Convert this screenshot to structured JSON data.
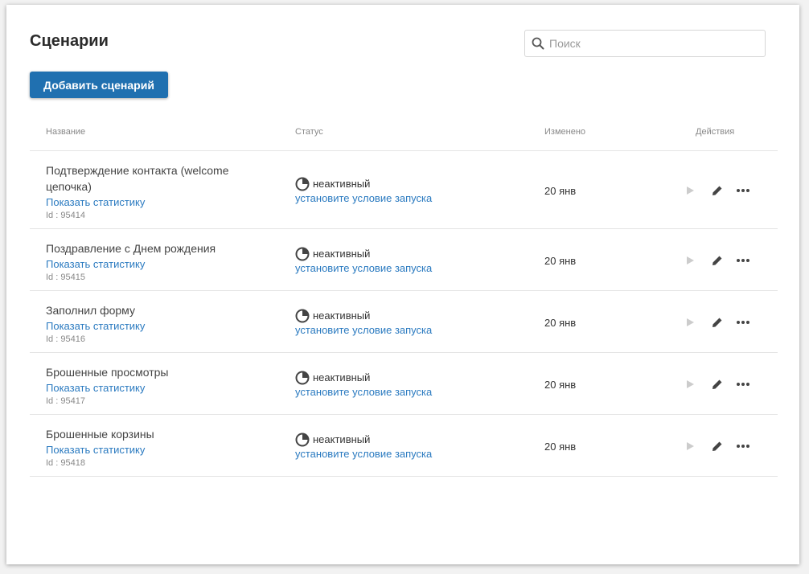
{
  "page": {
    "title": "Сценарии",
    "search_placeholder": "Поиск",
    "add_button": "Добавить сценарий"
  },
  "table": {
    "headers": {
      "name": "Название",
      "status": "Статус",
      "changed": "Изменено",
      "actions": "Действия"
    },
    "rows": [
      {
        "name": "Подтверждение контакта (welcome цепочка)",
        "stats_link": "Показать статистику",
        "id": "Id : 95414",
        "status": "неактивный",
        "status_link": "установите условие запуска",
        "changed": "20 янв"
      },
      {
        "name": "Поздравление с Днем рождения",
        "stats_link": "Показать статистику",
        "id": "Id : 95415",
        "status": "неактивный",
        "status_link": "установите условие запуска",
        "changed": "20 янв"
      },
      {
        "name": "Заполнил форму",
        "stats_link": "Показать статистику",
        "id": "Id : 95416",
        "status": "неактивный",
        "status_link": "установите условие запуска",
        "changed": "20 янв"
      },
      {
        "name": "Брошенные просмотры",
        "stats_link": "Показать статистику",
        "id": "Id : 95417",
        "status": "неактивный",
        "status_link": "установите условие запуска",
        "changed": "20 янв"
      },
      {
        "name": "Брошенные корзины",
        "stats_link": "Показать статистику",
        "id": "Id : 95418",
        "status": "неактивный",
        "status_link": "установите условие запуска",
        "changed": "20 янв"
      }
    ]
  },
  "icons": {
    "search": "search-icon",
    "status": "status-pie-icon",
    "play": "play-icon",
    "edit": "pencil-icon",
    "more": "more-dots-icon"
  },
  "colors": {
    "accent": "#2070b0",
    "link": "#2a7ac0",
    "play_disabled": "#cccccc",
    "icon_dark": "#444444"
  }
}
